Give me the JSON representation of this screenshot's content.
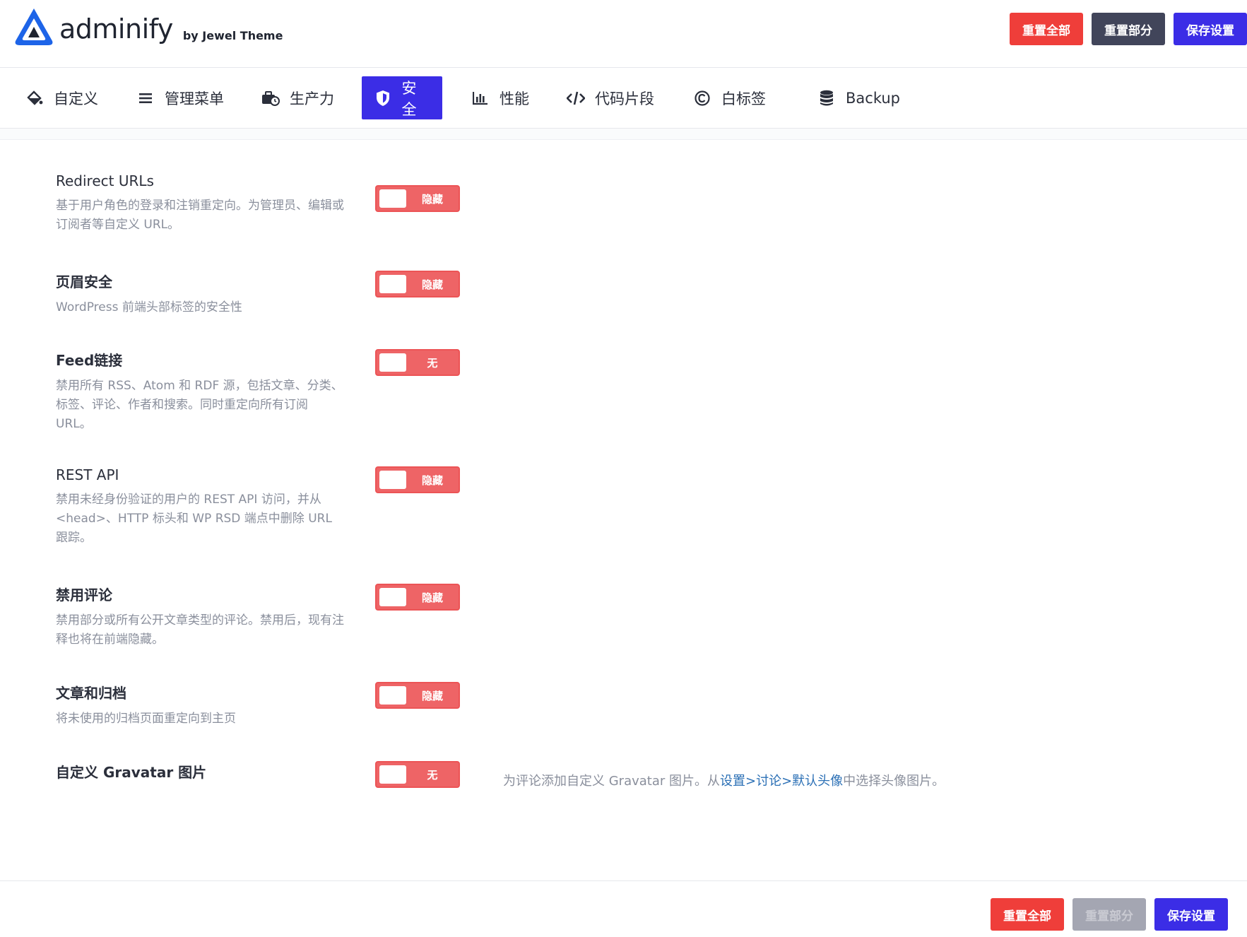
{
  "brand": {
    "name": "adminify",
    "by": "by Jewel Theme"
  },
  "actions": {
    "reset_all": "重置全部",
    "reset_section": "重置部分",
    "save": "保存设置"
  },
  "tabs": [
    {
      "label": "自定义",
      "icon": "paint-bucket-icon"
    },
    {
      "label": "管理菜单",
      "icon": "menu-lines-icon"
    },
    {
      "label": "生产力",
      "icon": "briefcase-clock-icon"
    },
    {
      "label": "安全",
      "icon": "shield-icon",
      "active": true
    },
    {
      "label": "性能",
      "icon": "bar-chart-icon"
    },
    {
      "label": "代码片段",
      "icon": "code-icon"
    },
    {
      "label": "白标签",
      "icon": "copyright-icon"
    },
    {
      "label": "Backup",
      "icon": "database-icon"
    }
  ],
  "settings": [
    {
      "title": "Redirect URLs",
      "desc": "基于用户角色的登录和注销重定向。为管理员、编辑或订阅者等自定义 URL。",
      "toggle": "隐藏"
    },
    {
      "title": "页眉安全",
      "desc": "WordPress 前端头部标签的安全性",
      "toggle": "隐藏"
    },
    {
      "title": "Feed链接",
      "desc": "禁用所有 RSS、Atom 和 RDF 源，包括文章、分类、标签、评论、作者和搜索。同时重定向所有订阅 URL。",
      "toggle": "无"
    },
    {
      "title": "REST API",
      "desc": "禁用未经身份验证的用户的 REST API 访问，并从 <head>、HTTP 标头和 WP RSD 端点中删除 URL 跟踪。",
      "toggle": "隐藏"
    },
    {
      "title": "禁用评论",
      "desc": "禁用部分或所有公开文章类型的评论。禁用后，现有注释也将在前端隐藏。",
      "toggle": "隐藏"
    },
    {
      "title": "文章和归档",
      "desc": "将未使用的归档页面重定向到主页",
      "toggle": "隐藏"
    },
    {
      "title": "自定义 Gravatar 图片",
      "desc": "",
      "toggle": "无",
      "help_prefix": "为评论添加自定义 Gravatar 图片。从",
      "help_link": "设置>讨论>默认头像",
      "help_suffix": "中选择头像图片。"
    }
  ],
  "colors": {
    "accent": "#3b2de6",
    "danger": "#ef3e3a",
    "dark": "#41455a",
    "toggle": "#ee6466"
  }
}
